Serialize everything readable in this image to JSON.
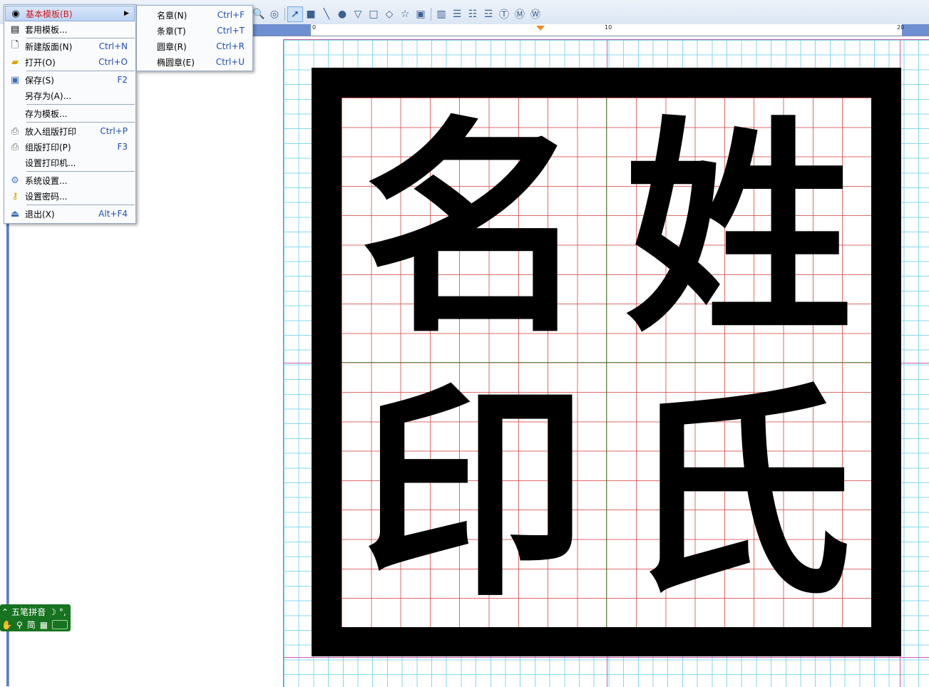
{
  "toolbar": {
    "icons": [
      "zoom-in-icon",
      "zoom-out-icon",
      "pointer-icon",
      "rectangle-fill-icon",
      "line-icon",
      "ellipse-icon",
      "triangle-down-icon",
      "square-icon",
      "diamond-icon",
      "star-icon",
      "image-icon",
      "barcode-icon",
      "text-horizontal-icon",
      "text-vertical-icon",
      "text-align-icon",
      "text-circle-icon",
      "text-m-circle-icon",
      "text-w-circle-icon"
    ]
  },
  "ruler": {
    "labels": [
      "0",
      "10",
      "20"
    ]
  },
  "file_menu": {
    "items": [
      {
        "label": "基本模板(B)",
        "shortcut": "",
        "icon": "template-icon",
        "submenu": true
      },
      {
        "label": "套用模板...",
        "shortcut": "",
        "icon": "apply-template-icon"
      },
      {
        "label": "新建版面(N)",
        "shortcut": "Ctrl+N",
        "icon": "new-page-icon"
      },
      {
        "label": "打开(O)",
        "shortcut": "Ctrl+O",
        "icon": "open-folder-icon"
      },
      {
        "label": "保存(S)",
        "shortcut": "F2",
        "icon": "save-icon"
      },
      {
        "label": "另存为(A)...",
        "shortcut": "",
        "icon": ""
      },
      {
        "label": "存为模板...",
        "shortcut": "",
        "icon": ""
      },
      {
        "label": "放入组版打印",
        "shortcut": "Ctrl+P",
        "icon": "add-print-icon"
      },
      {
        "label": "组版打印(P)",
        "shortcut": "F3",
        "icon": "printer-icon"
      },
      {
        "label": "设置打印机...",
        "shortcut": "",
        "icon": ""
      },
      {
        "label": "系统设置...",
        "shortcut": "",
        "icon": "gear-icon"
      },
      {
        "label": "设置密码...",
        "shortcut": "",
        "icon": "key-icon"
      },
      {
        "label": "退出(X)",
        "shortcut": "Alt+F4",
        "icon": "exit-icon"
      }
    ]
  },
  "template_submenu": {
    "items": [
      {
        "label": "名章(N)",
        "shortcut": "Ctrl+F"
      },
      {
        "label": "条章(T)",
        "shortcut": "Ctrl+T"
      },
      {
        "label": "圆章(R)",
        "shortcut": "Ctrl+R"
      },
      {
        "label": "椭圆章(E)",
        "shortcut": "Ctrl+U"
      }
    ]
  },
  "seal": {
    "characters": [
      "名",
      "姓",
      "印",
      "氏"
    ],
    "border_color": "#000000"
  },
  "ime": {
    "mode_label": "五笔拼音",
    "simp_label": "简"
  },
  "colors": {
    "accent": "#d11b1b",
    "shortcut": "#1e4fb5",
    "grid": "#6ed2eb",
    "guide": "#cc5aa8"
  }
}
